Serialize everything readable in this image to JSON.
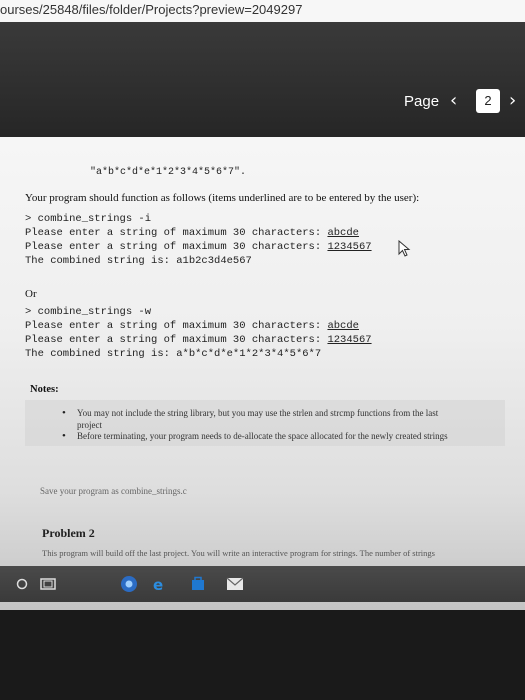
{
  "browser": {
    "url": "ourses/25848/files/folder/Projects?preview=2049297"
  },
  "viewer": {
    "page_label": "Page",
    "page_number": "2"
  },
  "document": {
    "example_result": "\"a*b*c*d*e*1*2*3*4*5*6*7\".",
    "instructions": "Your program should function as follows (items underlined are to be entered by the user):",
    "run1": {
      "command": "> combine_strings -i",
      "prompt1": "Please enter a string of maximum 30 characters: ",
      "input1": "abcde",
      "prompt2": "Please enter a string of maximum 30 characters: ",
      "input2": "1234567",
      "result": "The combined string is: a1b2c3d4e567"
    },
    "or_label": "Or",
    "run2": {
      "command": "> combine_strings -w",
      "prompt1": "Please enter a string of maximum 30 characters: ",
      "input1": "abcde",
      "prompt2": "Please enter a string of maximum 30 characters: ",
      "input2": "1234567",
      "result": "The combined string is: a*b*c*d*e*1*2*3*4*5*6*7"
    },
    "notes_title": "Notes:",
    "note1_line1": "You may not include the string library, but you may use the strlen and strcmp functions from the last",
    "note1_line2": "project",
    "note2": "Before terminating, your program needs to de-allocate the space allocated for the newly created strings",
    "save_text": "Save your program as combine_strings.c",
    "problem_title": "Problem 2",
    "problem_text": "This program will build off the last project. You will write an interactive program for strings. The number of strings"
  },
  "taskbar": {
    "icons": [
      "circle-icon",
      "window-icon",
      "chrome-icon",
      "edge-icon",
      "store-icon",
      "mail-icon"
    ]
  }
}
